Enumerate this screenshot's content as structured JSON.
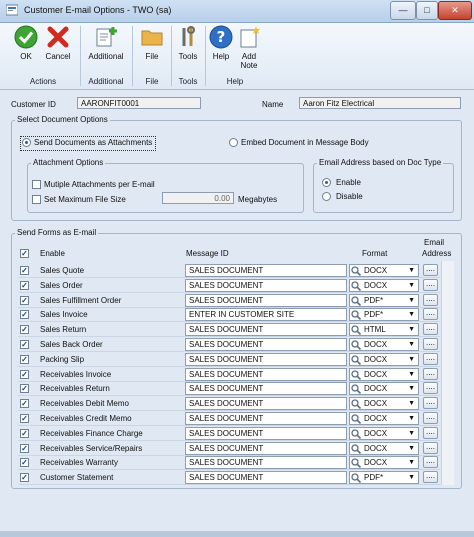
{
  "window": {
    "title": "Customer E-mail Options  -  TWO (sa)"
  },
  "ribbon": {
    "ok": "OK",
    "cancel": "Cancel",
    "additional": "Additional",
    "file": "File",
    "tools": "Tools",
    "help": "Help",
    "add_note_line1": "Add",
    "add_note_line2": "Note",
    "groups": {
      "actions": "Actions",
      "additional": "Additional",
      "file": "File",
      "tools": "Tools",
      "help": "Help"
    }
  },
  "customer": {
    "id_label": "Customer ID",
    "id_value": "AARONFIT0001",
    "name_label": "Name",
    "name_value": "Aaron Fitz Electrical"
  },
  "select_document": {
    "title": "Select Document Options",
    "send_attachments": "Send Documents as Attachments",
    "embed": "Embed Document in Message Body",
    "attachment_options": {
      "title": "Attachment Options",
      "multiple": "Mutiple Attachments per E-mail",
      "max_size": "Set Maximum File Size",
      "size_value": "0.00",
      "size_unit": "Megabytes"
    },
    "email_address": {
      "title": "Email Address based on Doc Type",
      "enable": "Enable",
      "disable": "Disable"
    }
  },
  "send_forms": {
    "title": "Send Forms as E-mail",
    "col_enable": "Enable",
    "col_message": "Message ID",
    "col_format": "Format",
    "col_email_line1": "Email",
    "col_email_line2": "Address",
    "dots": "....",
    "rows": [
      {
        "name": "Sales Quote",
        "message": "SALES DOCUMENT",
        "format": "DOCX"
      },
      {
        "name": "Sales Order",
        "message": "SALES DOCUMENT",
        "format": "DOCX"
      },
      {
        "name": "Sales Fulfillment Order",
        "message": "SALES DOCUMENT",
        "format": "PDF*"
      },
      {
        "name": "Sales Invoice",
        "message": "ENTER IN CUSTOMER SITE",
        "format": "PDF*"
      },
      {
        "name": "Sales Return",
        "message": "SALES DOCUMENT",
        "format": "HTML"
      },
      {
        "name": "Sales Back Order",
        "message": "SALES DOCUMENT",
        "format": "DOCX"
      },
      {
        "name": "Packing Slip",
        "message": "SALES DOCUMENT",
        "format": "DOCX"
      },
      {
        "name": "Receivables Invoice",
        "message": "SALES DOCUMENT",
        "format": "DOCX"
      },
      {
        "name": "Receivables Return",
        "message": "SALES DOCUMENT",
        "format": "DOCX"
      },
      {
        "name": "Receivables Debit Memo",
        "message": "SALES DOCUMENT",
        "format": "DOCX"
      },
      {
        "name": "Receivables Credit Memo",
        "message": "SALES DOCUMENT",
        "format": "DOCX"
      },
      {
        "name": "Receivables Finance Charge",
        "message": "SALES DOCUMENT",
        "format": "DOCX"
      },
      {
        "name": "Receivables Service/Repairs",
        "message": "SALES DOCUMENT",
        "format": "DOCX"
      },
      {
        "name": "Receivables Warranty",
        "message": "SALES DOCUMENT",
        "format": "DOCX"
      },
      {
        "name": "Customer Statement",
        "message": "SALES DOCUMENT",
        "format": "PDF*"
      }
    ]
  }
}
